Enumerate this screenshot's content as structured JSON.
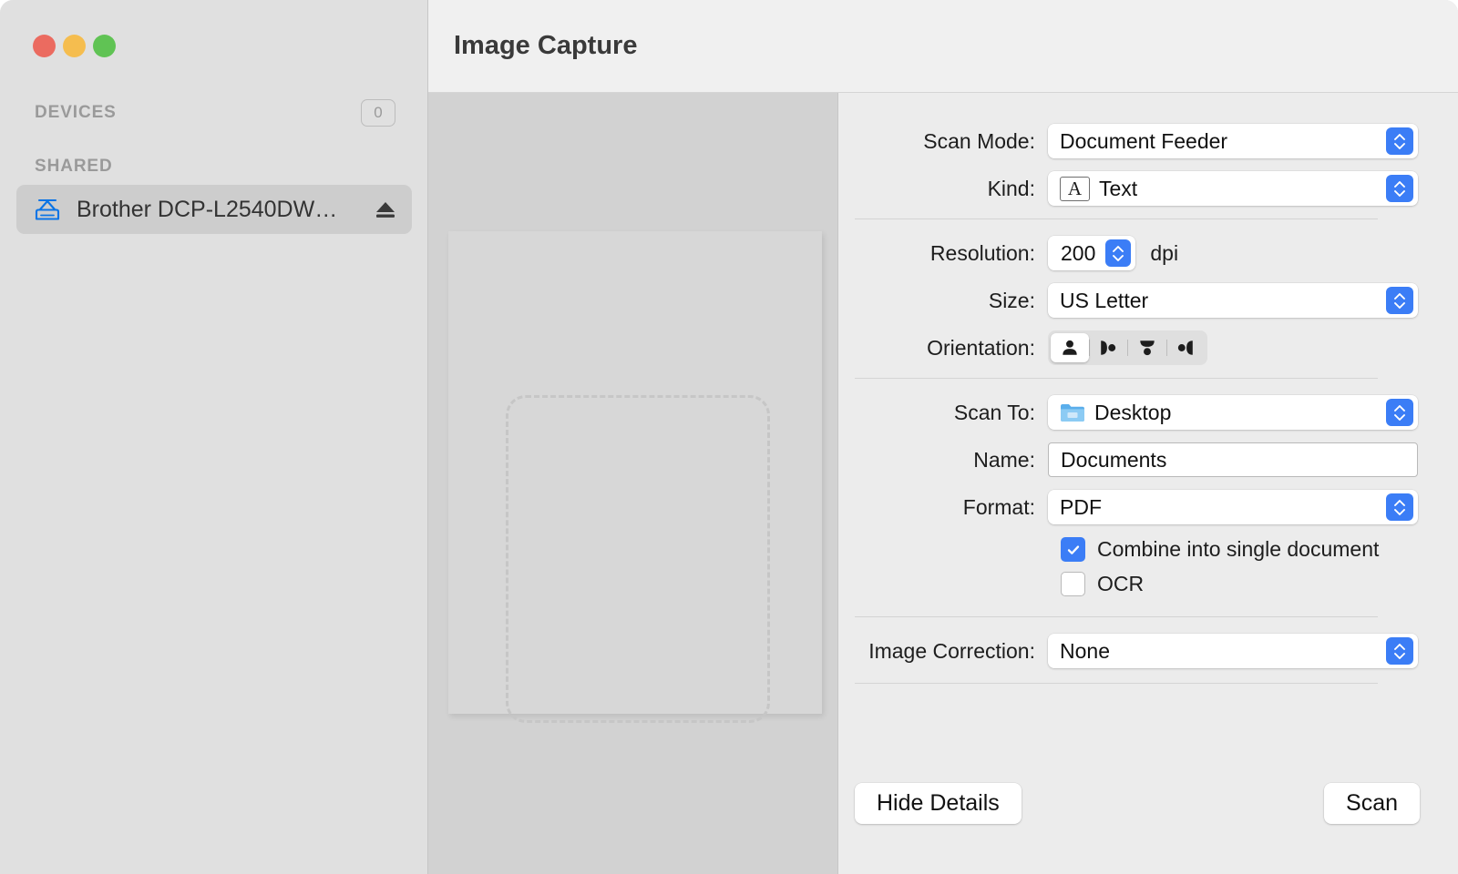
{
  "window": {
    "title": "Image Capture",
    "traffic_lights": [
      "close",
      "minimize",
      "zoom"
    ],
    "accent_color": "#3b7df6"
  },
  "sidebar": {
    "sections": [
      {
        "label": "DEVICES",
        "badge": "0",
        "items": []
      },
      {
        "label": "SHARED",
        "items": [
          {
            "label": "Brother DCP-L2540DW…",
            "icon": "scanner-icon",
            "selected": true,
            "eject": true
          }
        ]
      }
    ]
  },
  "preview": {
    "has_page": true,
    "selection_marquee": true
  },
  "scan_settings": {
    "scan_mode": {
      "label": "Scan Mode:",
      "value": "Document Feeder"
    },
    "kind": {
      "label": "Kind:",
      "value": "Text",
      "icon_text": "A"
    },
    "resolution": {
      "label": "Resolution:",
      "value": "200",
      "unit": "dpi"
    },
    "size": {
      "label": "Size:",
      "value": "US Letter"
    },
    "orientation": {
      "label": "Orientation:",
      "selected_index": 0,
      "options": [
        "portrait",
        "landscape-right",
        "portrait-upside-down",
        "landscape-left"
      ]
    },
    "scan_to": {
      "label": "Scan To:",
      "value": "Desktop",
      "icon": "folder-icon"
    },
    "name": {
      "label": "Name:",
      "value": "Documents",
      "placeholder": "Name"
    },
    "format": {
      "label": "Format:",
      "value": "PDF"
    },
    "combine": {
      "label": "Combine into single document",
      "checked": true
    },
    "ocr": {
      "label": "OCR",
      "checked": false
    },
    "image_correction": {
      "label": "Image Correction:",
      "value": "None"
    }
  },
  "footer": {
    "hide_details_label": "Hide Details",
    "scan_label": "Scan"
  }
}
